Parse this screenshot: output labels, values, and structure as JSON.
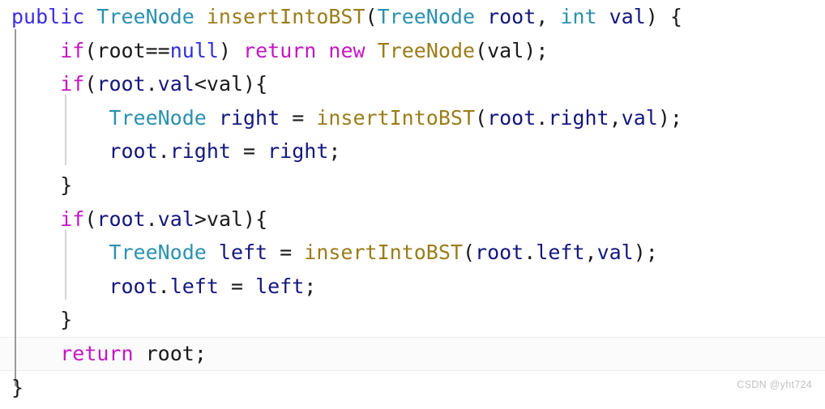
{
  "editor": {
    "language": "java",
    "background_color": "#ffffff",
    "current_line_number": 11,
    "current_line_highlight_color": "#fbfbfb",
    "indent_guide_colors": {
      "method_level": "#9a9a9a",
      "block_level": "#d6d6d6"
    },
    "token_colors": {
      "modifier": "#3c2ee0",
      "type": "#2b91af",
      "method": "#9a7d1a",
      "variable": "#13177e",
      "control": "#c317c3",
      "null_literal": "#2d30d8",
      "plain": "#1a1a1a"
    }
  },
  "code": {
    "lines": [
      {
        "n": 1,
        "text": "public TreeNode insertIntoBST(TreeNode root, int val) {",
        "tokens": [
          {
            "t": "public",
            "c": "tok-modifier"
          },
          {
            "t": " ",
            "c": "tok-plain"
          },
          {
            "t": "TreeNode",
            "c": "tok-type"
          },
          {
            "t": " ",
            "c": "tok-plain"
          },
          {
            "t": "insertIntoBST",
            "c": "tok-method"
          },
          {
            "t": "(",
            "c": "tok-plain"
          },
          {
            "t": "TreeNode",
            "c": "tok-type"
          },
          {
            "t": " ",
            "c": "tok-plain"
          },
          {
            "t": "root",
            "c": "tok-var"
          },
          {
            "t": ", ",
            "c": "tok-plain"
          },
          {
            "t": "int",
            "c": "tok-type"
          },
          {
            "t": " ",
            "c": "tok-plain"
          },
          {
            "t": "val",
            "c": "tok-var"
          },
          {
            "t": ") ",
            "c": "tok-plain"
          },
          {
            "t": "{",
            "c": "tok-brace"
          }
        ]
      },
      {
        "n": 2,
        "text": "    if(root==null) return new TreeNode(val);",
        "tokens": [
          {
            "t": "    ",
            "c": "tok-plain"
          },
          {
            "t": "if",
            "c": "tok-ctrl"
          },
          {
            "t": "(",
            "c": "tok-plain"
          },
          {
            "t": "root",
            "c": "tok-plain"
          },
          {
            "t": "==",
            "c": "tok-plain"
          },
          {
            "t": "null",
            "c": "tok-null"
          },
          {
            "t": ") ",
            "c": "tok-plain"
          },
          {
            "t": "return",
            "c": "tok-ctrl"
          },
          {
            "t": " ",
            "c": "tok-plain"
          },
          {
            "t": "new",
            "c": "tok-ctrl"
          },
          {
            "t": " ",
            "c": "tok-plain"
          },
          {
            "t": "TreeNode",
            "c": "tok-method"
          },
          {
            "t": "(",
            "c": "tok-plain"
          },
          {
            "t": "val",
            "c": "tok-plain"
          },
          {
            "t": ");",
            "c": "tok-plain"
          }
        ]
      },
      {
        "n": 3,
        "text": "    if(root.val<val){",
        "tokens": [
          {
            "t": "    ",
            "c": "tok-plain"
          },
          {
            "t": "if",
            "c": "tok-ctrl"
          },
          {
            "t": "(",
            "c": "tok-plain"
          },
          {
            "t": "root",
            "c": "tok-var"
          },
          {
            "t": ".",
            "c": "tok-plain"
          },
          {
            "t": "val",
            "c": "tok-var"
          },
          {
            "t": "<",
            "c": "tok-plain"
          },
          {
            "t": "val",
            "c": "tok-plain"
          },
          {
            "t": "){",
            "c": "tok-plain"
          }
        ]
      },
      {
        "n": 4,
        "text": "        TreeNode right = insertIntoBST(root.right,val);",
        "tokens": [
          {
            "t": "        ",
            "c": "tok-plain"
          },
          {
            "t": "TreeNode",
            "c": "tok-type"
          },
          {
            "t": " ",
            "c": "tok-plain"
          },
          {
            "t": "right",
            "c": "tok-var"
          },
          {
            "t": " = ",
            "c": "tok-plain"
          },
          {
            "t": "insertIntoBST",
            "c": "tok-method"
          },
          {
            "t": "(",
            "c": "tok-plain"
          },
          {
            "t": "root",
            "c": "tok-var"
          },
          {
            "t": ".",
            "c": "tok-plain"
          },
          {
            "t": "right",
            "c": "tok-var"
          },
          {
            "t": ",",
            "c": "tok-plain"
          },
          {
            "t": "val",
            "c": "tok-var"
          },
          {
            "t": ");",
            "c": "tok-plain"
          }
        ]
      },
      {
        "n": 5,
        "text": "        root.right = right;",
        "tokens": [
          {
            "t": "        ",
            "c": "tok-plain"
          },
          {
            "t": "root",
            "c": "tok-var"
          },
          {
            "t": ".",
            "c": "tok-plain"
          },
          {
            "t": "right",
            "c": "tok-var"
          },
          {
            "t": " = ",
            "c": "tok-plain"
          },
          {
            "t": "right",
            "c": "tok-var"
          },
          {
            "t": ";",
            "c": "tok-plain"
          }
        ]
      },
      {
        "n": 6,
        "text": "    }",
        "tokens": [
          {
            "t": "    ",
            "c": "tok-plain"
          },
          {
            "t": "}",
            "c": "tok-brace"
          }
        ]
      },
      {
        "n": 7,
        "text": "    if(root.val>val){",
        "tokens": [
          {
            "t": "    ",
            "c": "tok-plain"
          },
          {
            "t": "if",
            "c": "tok-ctrl"
          },
          {
            "t": "(",
            "c": "tok-plain"
          },
          {
            "t": "root",
            "c": "tok-var"
          },
          {
            "t": ".",
            "c": "tok-plain"
          },
          {
            "t": "val",
            "c": "tok-var"
          },
          {
            "t": ">",
            "c": "tok-plain"
          },
          {
            "t": "val",
            "c": "tok-plain"
          },
          {
            "t": "){",
            "c": "tok-plain"
          }
        ]
      },
      {
        "n": 8,
        "text": "        TreeNode left = insertIntoBST(root.left,val);",
        "tokens": [
          {
            "t": "        ",
            "c": "tok-plain"
          },
          {
            "t": "TreeNode",
            "c": "tok-type"
          },
          {
            "t": " ",
            "c": "tok-plain"
          },
          {
            "t": "left",
            "c": "tok-var"
          },
          {
            "t": " = ",
            "c": "tok-plain"
          },
          {
            "t": "insertIntoBST",
            "c": "tok-method"
          },
          {
            "t": "(",
            "c": "tok-plain"
          },
          {
            "t": "root",
            "c": "tok-var"
          },
          {
            "t": ".",
            "c": "tok-plain"
          },
          {
            "t": "left",
            "c": "tok-var"
          },
          {
            "t": ",",
            "c": "tok-plain"
          },
          {
            "t": "val",
            "c": "tok-var"
          },
          {
            "t": ");",
            "c": "tok-plain"
          }
        ]
      },
      {
        "n": 9,
        "text": "        root.left = left;",
        "tokens": [
          {
            "t": "        ",
            "c": "tok-plain"
          },
          {
            "t": "root",
            "c": "tok-var"
          },
          {
            "t": ".",
            "c": "tok-plain"
          },
          {
            "t": "left",
            "c": "tok-var"
          },
          {
            "t": " = ",
            "c": "tok-plain"
          },
          {
            "t": "left",
            "c": "tok-var"
          },
          {
            "t": ";",
            "c": "tok-plain"
          }
        ]
      },
      {
        "n": 10,
        "text": "    }",
        "tokens": [
          {
            "t": "    ",
            "c": "tok-plain"
          },
          {
            "t": "}",
            "c": "tok-brace"
          }
        ]
      },
      {
        "n": 11,
        "text": "    return root;",
        "tokens": [
          {
            "t": "    ",
            "c": "tok-plain"
          },
          {
            "t": "return",
            "c": "tok-ctrl"
          },
          {
            "t": " ",
            "c": "tok-plain"
          },
          {
            "t": "root",
            "c": "tok-plain"
          },
          {
            "t": ";",
            "c": "tok-plain"
          }
        ]
      },
      {
        "n": 12,
        "text": "}",
        "tokens": [
          {
            "t": "}",
            "c": "tok-brace"
          }
        ]
      }
    ]
  },
  "watermark": {
    "text": "CSDN @yht724",
    "color": "#c2c2c2"
  }
}
